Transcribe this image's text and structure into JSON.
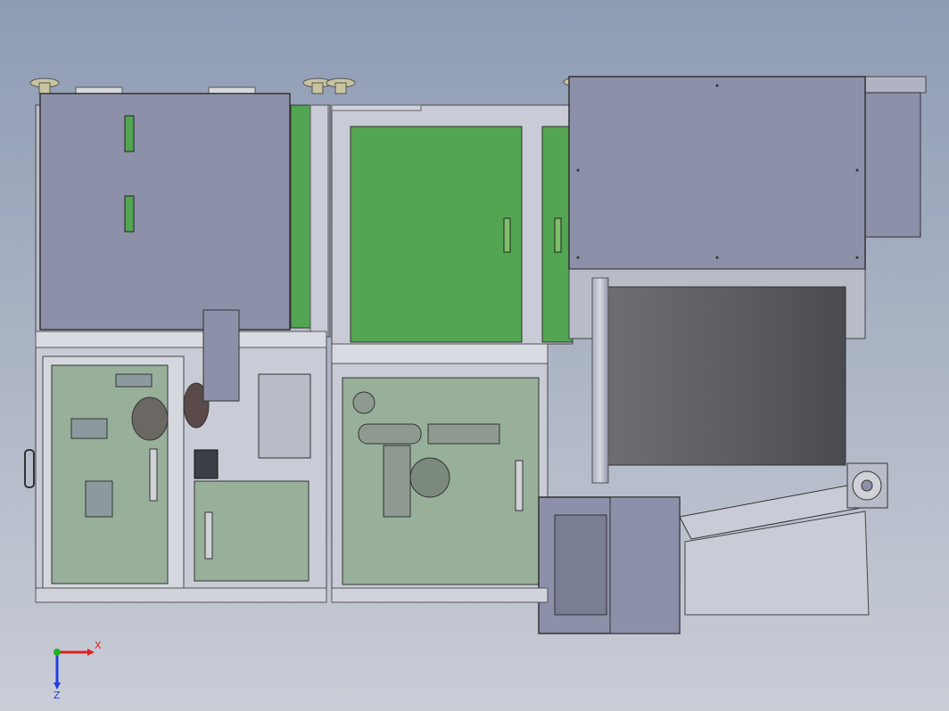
{
  "scene": {
    "model": "machine-assembly-front-view",
    "colors": {
      "background_top": "#8e9bb4",
      "background_bottom": "#c9cdd6",
      "panel_gray": "#8c90a8",
      "panel_dark": "#6e7288",
      "frame_light": "#c9ccd6",
      "door_green": "#53a552",
      "glass_green": "#98b09a",
      "cover_dark": "#5a5a60"
    }
  },
  "triad": {
    "x_label": "X",
    "z_label": "Z",
    "x_color": "#e02020",
    "y_color": "#20b020",
    "z_color": "#2040e0"
  }
}
